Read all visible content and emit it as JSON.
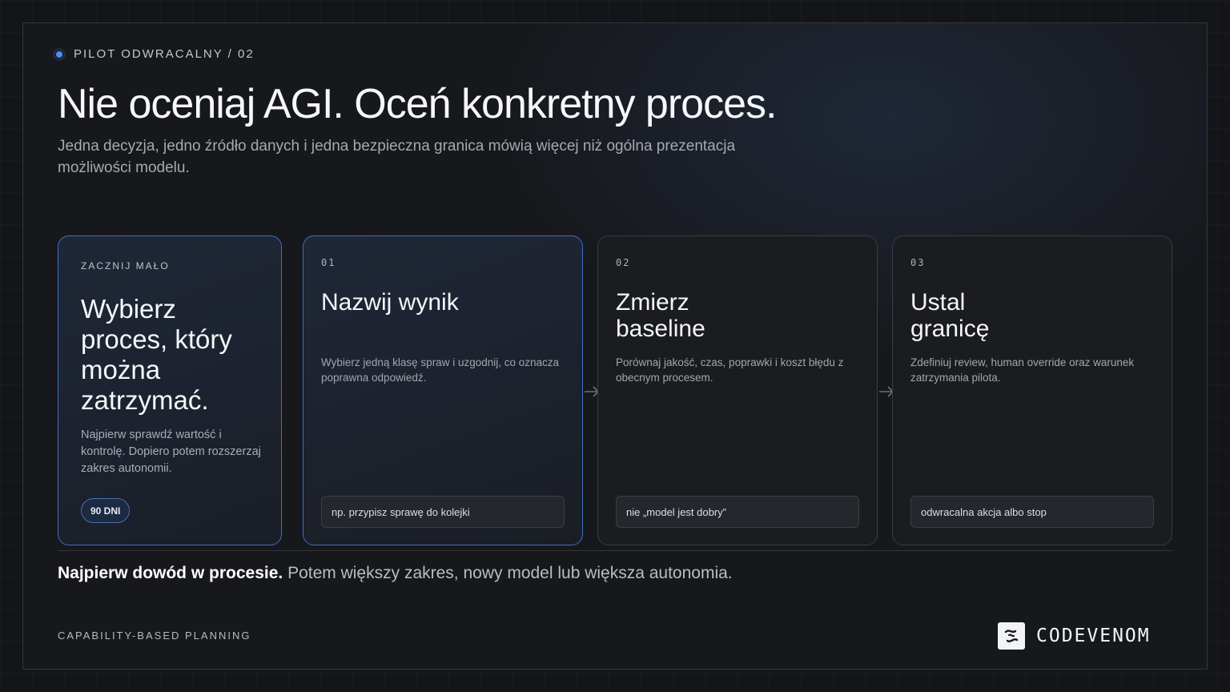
{
  "header": {
    "eyebrow": "PILOT ODWRACALNY / 02",
    "title": "Nie oceniaj AGI. Oceń konkretny proces.",
    "subtitle": "Jedna decyzja, jedno źródło danych i jedna bezpieczna granica mówią więcej niż ogólna prezentacja możliwości modelu."
  },
  "start_card": {
    "label": "ZACZNIJ MAŁO",
    "title": "Wybierz proces, który można zatrzymać.",
    "description": "Najpierw sprawdź wartość i kontrolę. Dopiero potem rozszerzaj zakres autonomii.",
    "badge": "90 DNI"
  },
  "steps": [
    {
      "number": "01",
      "title": "Nazwij wynik",
      "description": "Wybierz jedną klasę spraw i uzgodnij, co oznacza poprawna odpowiedź.",
      "example": "np. przypisz sprawę do kolejki"
    },
    {
      "number": "02",
      "title": "Zmierz baseline",
      "description": "Porównaj jakość, czas, poprawki i koszt błędu z obecnym procesem.",
      "example": "nie „model jest dobry”"
    },
    {
      "number": "03",
      "title": "Ustal granicę",
      "description": "Zdefiniuj review, human override oraz warunek zatrzymania pilota.",
      "example": "odwracalna akcja albo stop"
    }
  ],
  "bottom": {
    "strong": "Najpierw dowód w procesie.",
    "rest": " Potem większy zakres, nowy model lub większa autonomia."
  },
  "footer": {
    "left": "CAPABILITY-BASED PLANNING",
    "brand": "CODEVENOM"
  },
  "colors": {
    "accent": "#4d8dff",
    "background": "#17181c",
    "card_border_active": "#3e6fc4"
  },
  "icons": {
    "eyebrow": "status-dot-icon",
    "step_connector": "arrow-right-icon",
    "brand": "codevenom-logo-icon"
  }
}
